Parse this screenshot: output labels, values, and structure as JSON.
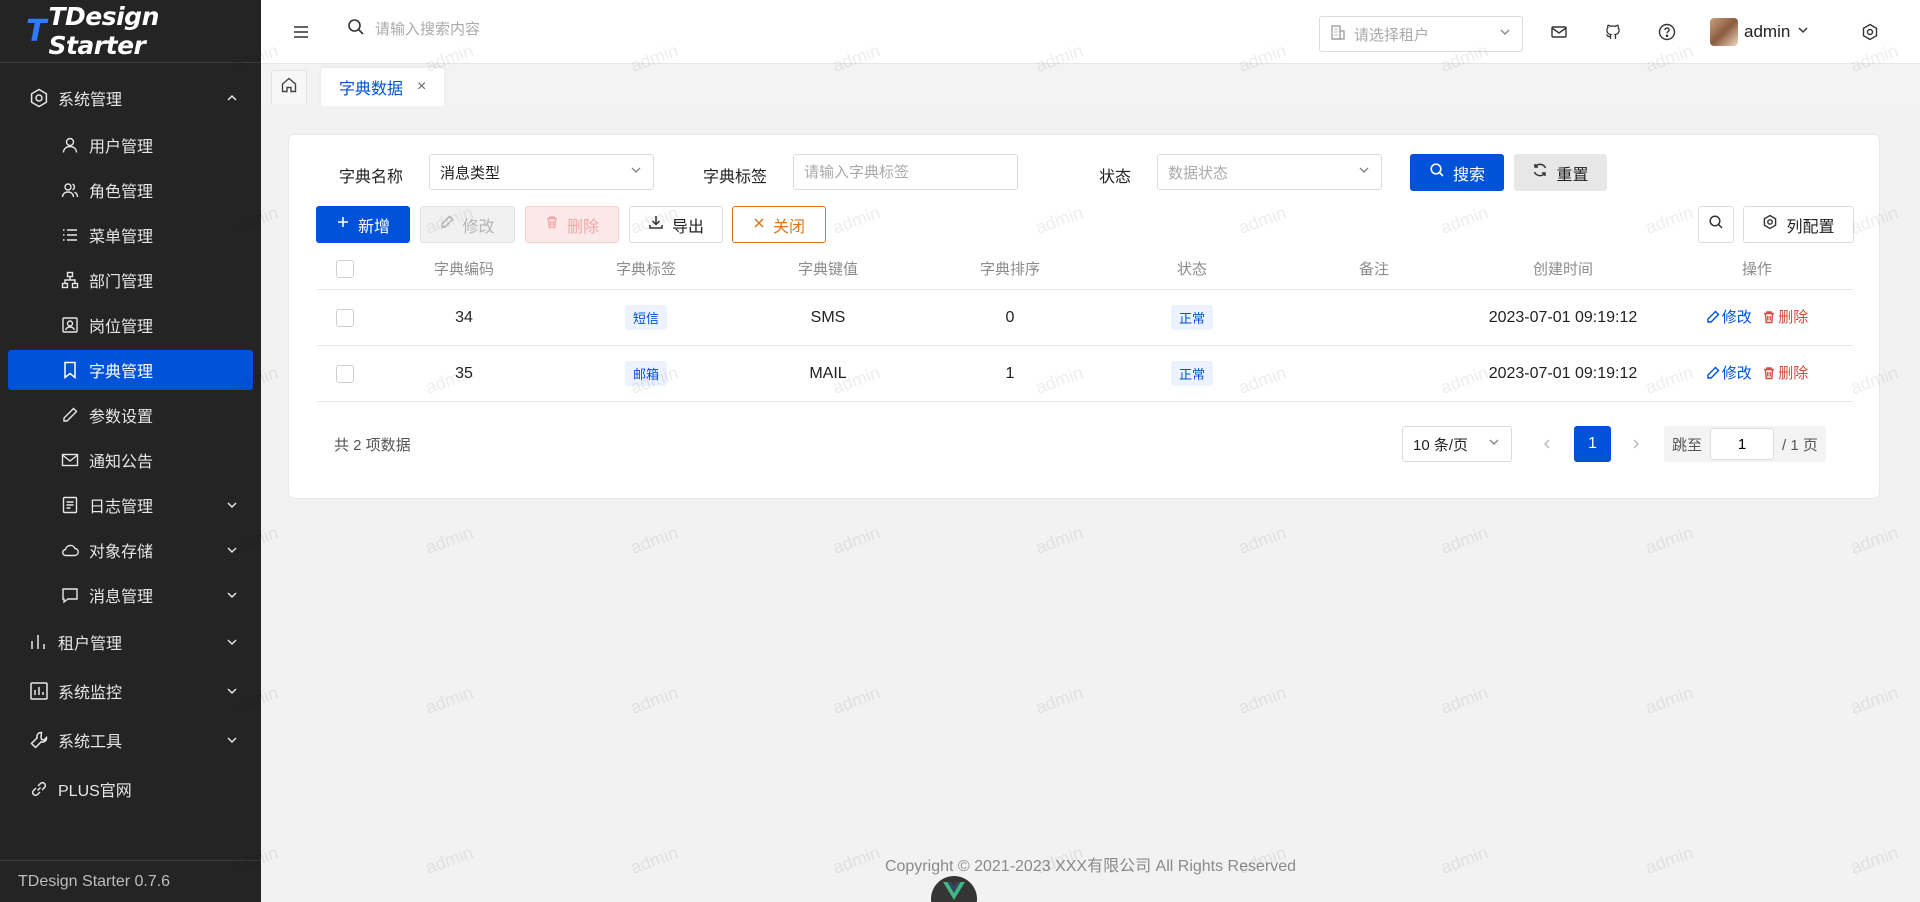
{
  "sidebar": {
    "logo_mark": "T",
    "logo_text": "TDesign Starter",
    "groups": [
      {
        "label": "系统管理",
        "icon": "setting-icon",
        "expanded": true
      },
      {
        "label": "租户管理",
        "icon": "chart-bar-icon"
      },
      {
        "label": "系统监控",
        "icon": "monitor-icon"
      },
      {
        "label": "系统工具",
        "icon": "tool-icon"
      },
      {
        "label": "PLUS官网",
        "icon": "link-icon"
      }
    ],
    "items": [
      {
        "label": "用户管理",
        "icon": "user-icon"
      },
      {
        "label": "角色管理",
        "icon": "users-icon"
      },
      {
        "label": "菜单管理",
        "icon": "list-icon"
      },
      {
        "label": "部门管理",
        "icon": "org-tree-icon"
      },
      {
        "label": "岗位管理",
        "icon": "badge-icon"
      },
      {
        "label": "字典管理",
        "icon": "bookmark-icon",
        "active": true
      },
      {
        "label": "参数设置",
        "icon": "edit-icon"
      },
      {
        "label": "通知公告",
        "icon": "mail-icon"
      },
      {
        "label": "日志管理",
        "icon": "log-icon"
      },
      {
        "label": "对象存储",
        "icon": "cloud-icon"
      },
      {
        "label": "消息管理",
        "icon": "chat-icon"
      }
    ],
    "footer": "TDesign Starter 0.7.6"
  },
  "header": {
    "search_placeholder": "请输入搜索内容",
    "tenant_placeholder": "请选择租户",
    "username": "admin"
  },
  "tabs": {
    "active_label": "字典数据",
    "close": "×"
  },
  "filter": {
    "dict_name_label": "字典名称",
    "dict_name_value": "消息类型",
    "dict_label_label": "字典标签",
    "dict_label_placeholder": "请输入字典标签",
    "status_label": "状态",
    "status_placeholder": "数据状态",
    "search_btn": "搜索",
    "reset_btn": "重置"
  },
  "toolbar": {
    "add": "新增",
    "edit": "修改",
    "delete": "删除",
    "export": "导出",
    "close": "关闭",
    "column_config": "列配置"
  },
  "table": {
    "columns": [
      "字典编码",
      "字典标签",
      "字典键值",
      "字典排序",
      "状态",
      "备注",
      "创建时间",
      "操作"
    ],
    "rows": [
      {
        "code": "34",
        "label": "短信",
        "key": "SMS",
        "sort": "0",
        "status": "正常",
        "remark": "",
        "created": "2023-07-01 09:19:12"
      },
      {
        "code": "35",
        "label": "邮箱",
        "key": "MAIL",
        "sort": "1",
        "status": "正常",
        "remark": "",
        "created": "2023-07-01 09:19:12"
      }
    ],
    "op_edit": "修改",
    "op_delete": "删除"
  },
  "pagination": {
    "total": "共 2 项数据",
    "page_size": "10 条/页",
    "current": "1",
    "jump_label": "跳至",
    "jump_value": "1",
    "total_pages": "/ 1 页"
  },
  "footer": {
    "copyright": "Copyright © 2021-2023 XXX有限公司 All Rights Reserved"
  },
  "watermark_text": "admin",
  "colors": {
    "primary": "#0052d9",
    "danger": "#d54941",
    "warning": "#e37318",
    "sidebar_bg": "#242424"
  }
}
